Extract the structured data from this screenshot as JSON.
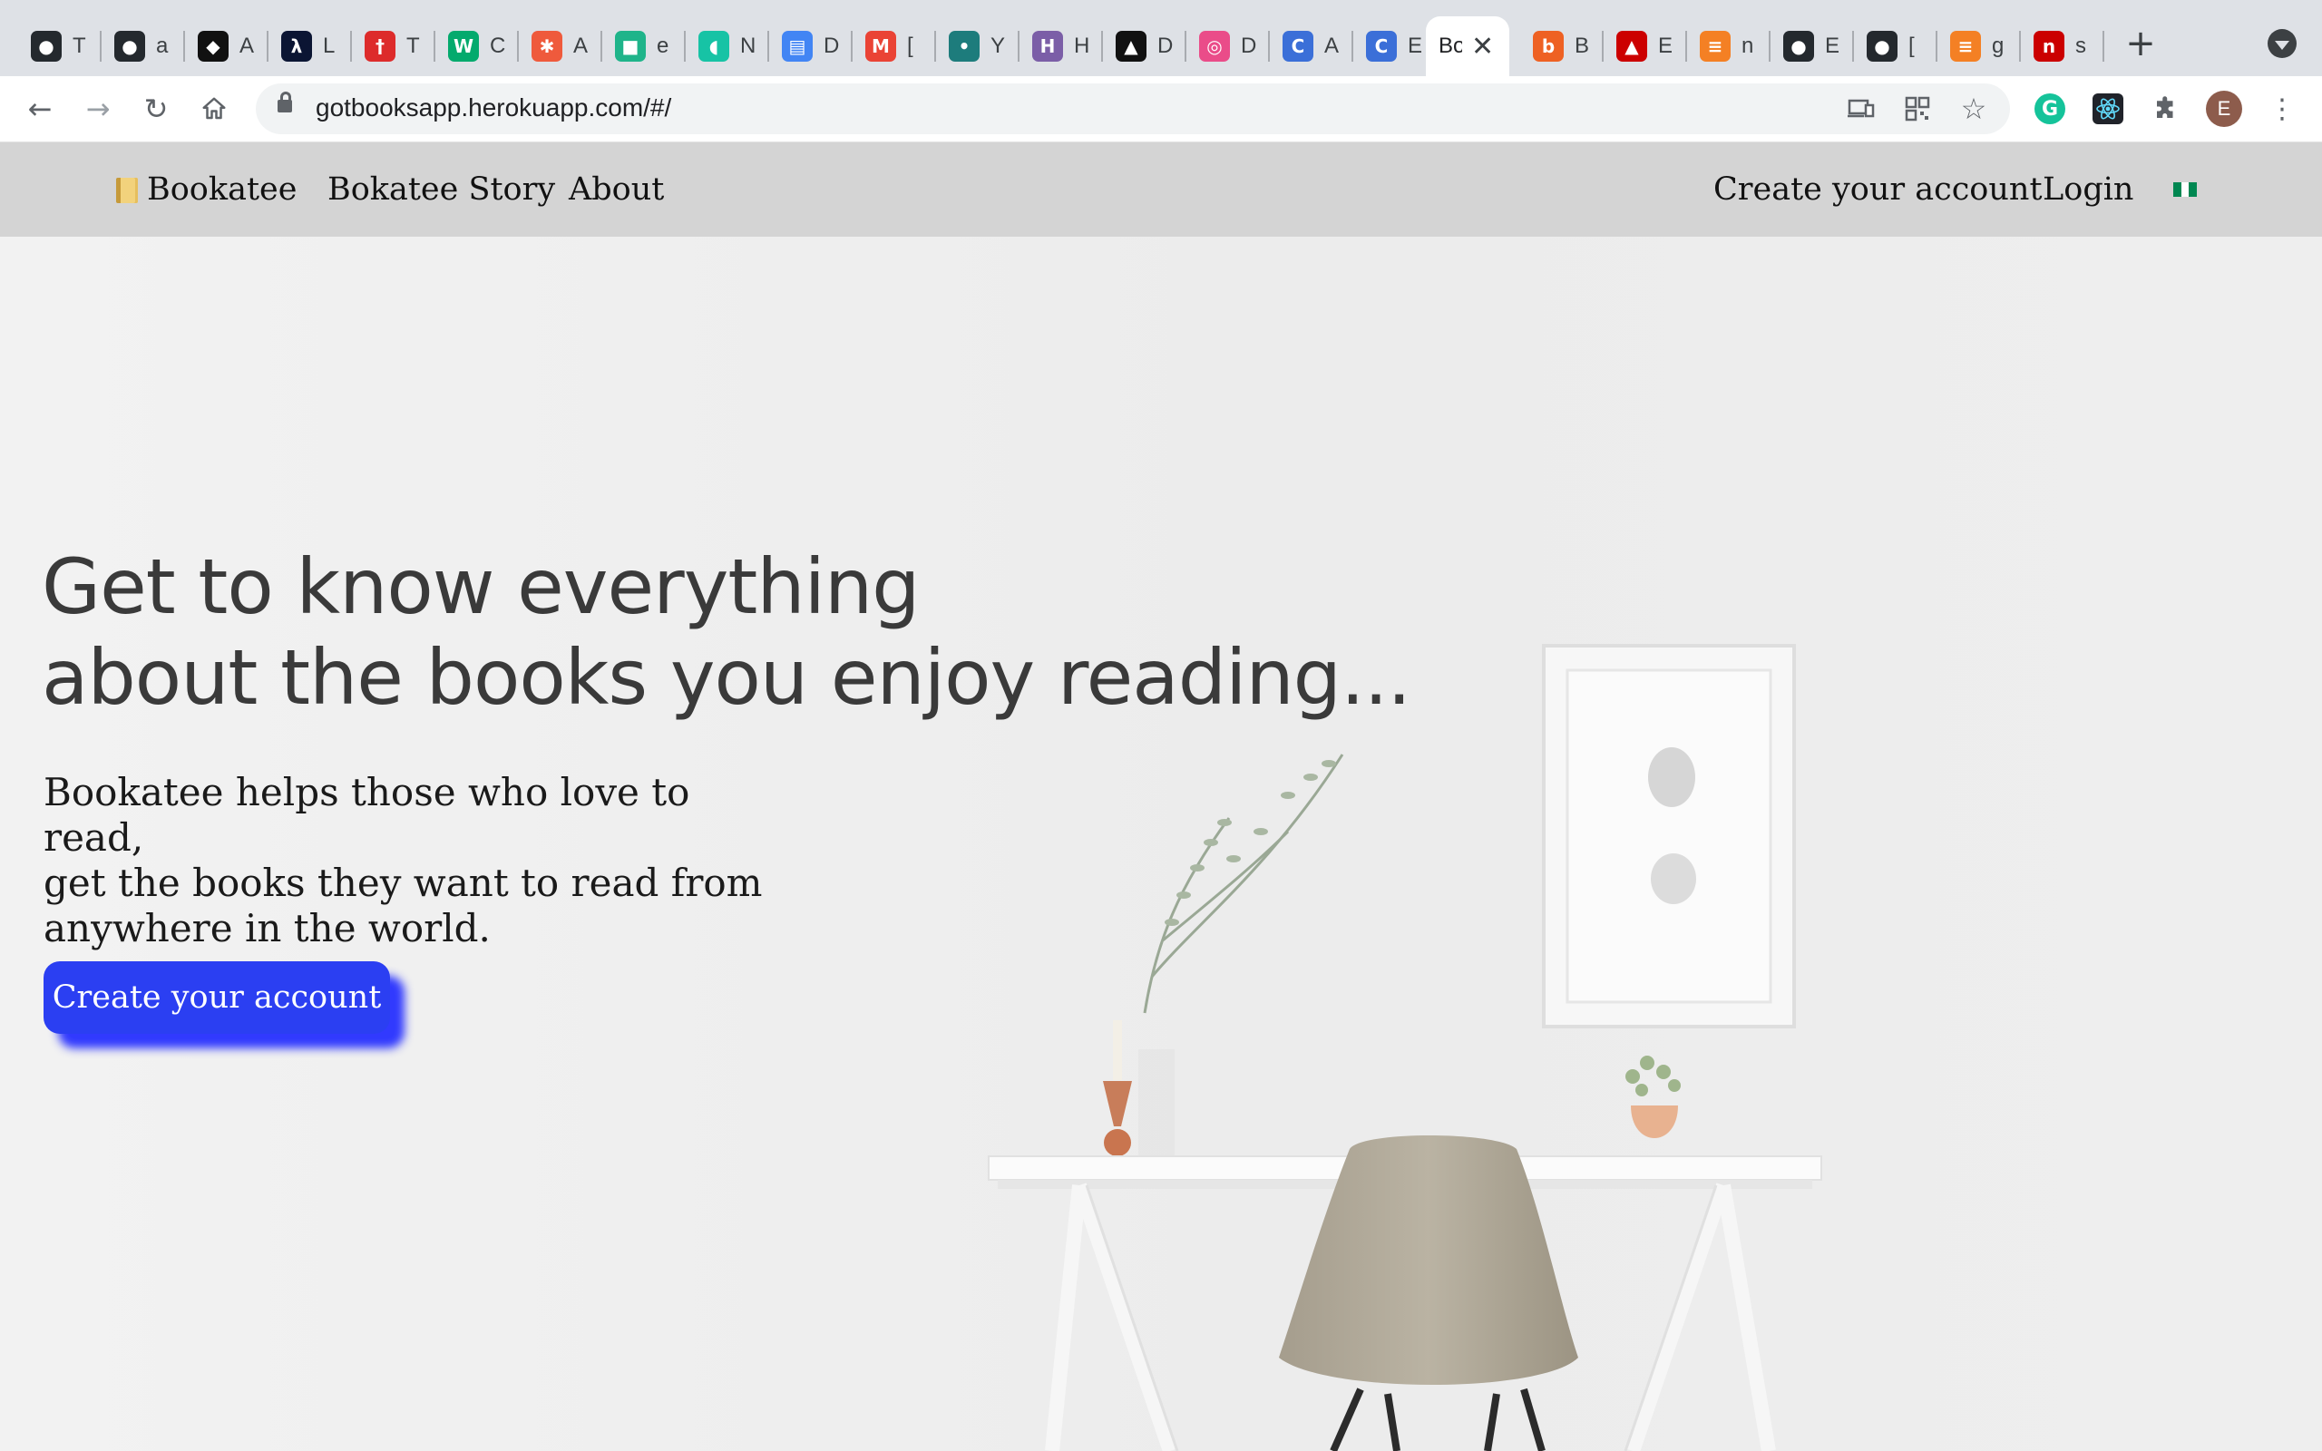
{
  "browser": {
    "tabs": [
      {
        "icon": "github-icon",
        "label": "T",
        "bg": "#24292e"
      },
      {
        "icon": "github-icon",
        "label": "a",
        "bg": "#24292e"
      },
      {
        "icon": "codepen-icon",
        "label": "A",
        "bg": "#111111"
      },
      {
        "icon": "lambda-icon",
        "label": "L",
        "bg": "#0b1533"
      },
      {
        "icon": "tower-icon",
        "label": "T",
        "bg": "#dd2b2b"
      },
      {
        "icon": "w3schools-icon",
        "label": "C",
        "bg": "#04aa6d"
      },
      {
        "icon": "asterisk-icon",
        "label": "A",
        "bg": "#ef5a3c"
      },
      {
        "icon": "app-icon",
        "label": "e",
        "bg": "#1fb48a"
      },
      {
        "icon": "bookmark-icon",
        "label": "N",
        "bg": "#17c3a5"
      },
      {
        "icon": "docs-icon",
        "label": "D",
        "bg": "#4285f4"
      },
      {
        "icon": "gmail-icon",
        "label": "[",
        "bg": "#ea4335"
      },
      {
        "icon": "drop-icon",
        "label": "Y",
        "bg": "#1d7c7c"
      },
      {
        "icon": "heroku-icon",
        "label": "H",
        "bg": "#7b5ea7"
      },
      {
        "icon": "cap-icon",
        "label": "D",
        "bg": "#111111"
      },
      {
        "icon": "dribbble-icon",
        "label": "D",
        "bg": "#ea4c89"
      },
      {
        "icon": "c-icon",
        "label": "A",
        "bg": "#3b6fd8"
      },
      {
        "icon": "c-icon",
        "label": "E",
        "bg": "#3b6fd8"
      },
      {
        "icon": "",
        "label": "Bo",
        "bg": "",
        "active": true
      },
      {
        "icon": "bitly-icon",
        "label": "B",
        "bg": "#ee6123"
      },
      {
        "icon": "redhat-icon",
        "label": "E",
        "bg": "#cc0000"
      },
      {
        "icon": "stackoverflow-icon",
        "label": "n",
        "bg": "#f48024"
      },
      {
        "icon": "github-icon",
        "label": "E",
        "bg": "#24292e"
      },
      {
        "icon": "github-icon",
        "label": "[",
        "bg": "#24292e"
      },
      {
        "icon": "stackoverflow-icon",
        "label": "g",
        "bg": "#f48024"
      },
      {
        "icon": "npm-icon",
        "label": "s",
        "bg": "#cb0000"
      }
    ],
    "url": "gotbooksapp.herokuapp.com/#/",
    "profile_initial": "E"
  },
  "site": {
    "brand": "Bookatee",
    "nav": {
      "story": "Bokatee Story",
      "about": "About",
      "create_account": "Create your account",
      "login": "Login"
    },
    "flag_colors": [
      "#008751",
      "#ffffff",
      "#008751"
    ]
  },
  "hero": {
    "title_line1": "Get to know everything",
    "title_line2": "about the books you enjoy reading...",
    "subtitle_line1": "Bookatee helps those who love to read,",
    "subtitle_line2": "get the books they want to read from",
    "subtitle_line3": "anywhere in the world.",
    "cta_label": "Create your account",
    "cta_color": "#2b3ff2"
  }
}
